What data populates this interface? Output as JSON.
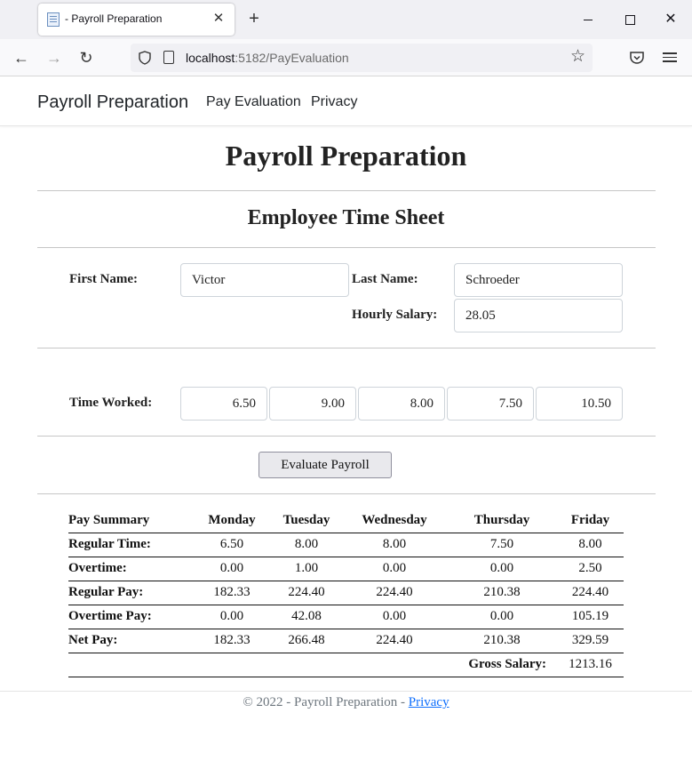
{
  "browser": {
    "tab_title": "- Payroll Preparation",
    "url_host": "localhost",
    "url_rest": ":5182/PayEvaluation"
  },
  "site": {
    "brand": "Payroll Preparation",
    "nav": [
      "Pay Evaluation",
      "Privacy"
    ]
  },
  "page": {
    "title": "Payroll Preparation",
    "subtitle": "Employee Time Sheet"
  },
  "form": {
    "first_name_label": "First Name:",
    "first_name": "Victor",
    "last_name_label": "Last Name:",
    "last_name": "Schroeder",
    "hourly_salary_label": "Hourly Salary:",
    "hourly_salary": "28.05",
    "time_worked_label": "Time Worked:",
    "time_worked": [
      "6.50",
      "9.00",
      "8.00",
      "7.50",
      "10.50"
    ],
    "evaluate_button": "Evaluate Payroll"
  },
  "summary": {
    "headers": [
      "Pay Summary",
      "Monday",
      "Tuesday",
      "Wednesday",
      "Thursday",
      "Friday"
    ],
    "rows": [
      {
        "label": "Regular Time:",
        "values": [
          "6.50",
          "8.00",
          "8.00",
          "7.50",
          "8.00"
        ]
      },
      {
        "label": "Overtime:",
        "values": [
          "0.00",
          "1.00",
          "0.00",
          "0.00",
          "2.50"
        ]
      },
      {
        "label": "Regular Pay:",
        "values": [
          "182.33",
          "224.40",
          "224.40",
          "210.38",
          "224.40"
        ]
      },
      {
        "label": "Overtime Pay:",
        "values": [
          "0.00",
          "42.08",
          "0.00",
          "0.00",
          "105.19"
        ]
      },
      {
        "label": "Net Pay:",
        "values": [
          "182.33",
          "266.48",
          "224.40",
          "210.38",
          "329.59"
        ]
      }
    ],
    "gross_label": "Gross Salary:",
    "gross_value": "1213.16"
  },
  "footer": {
    "text": "© 2022 - Payroll Preparation - ",
    "link": "Privacy"
  }
}
